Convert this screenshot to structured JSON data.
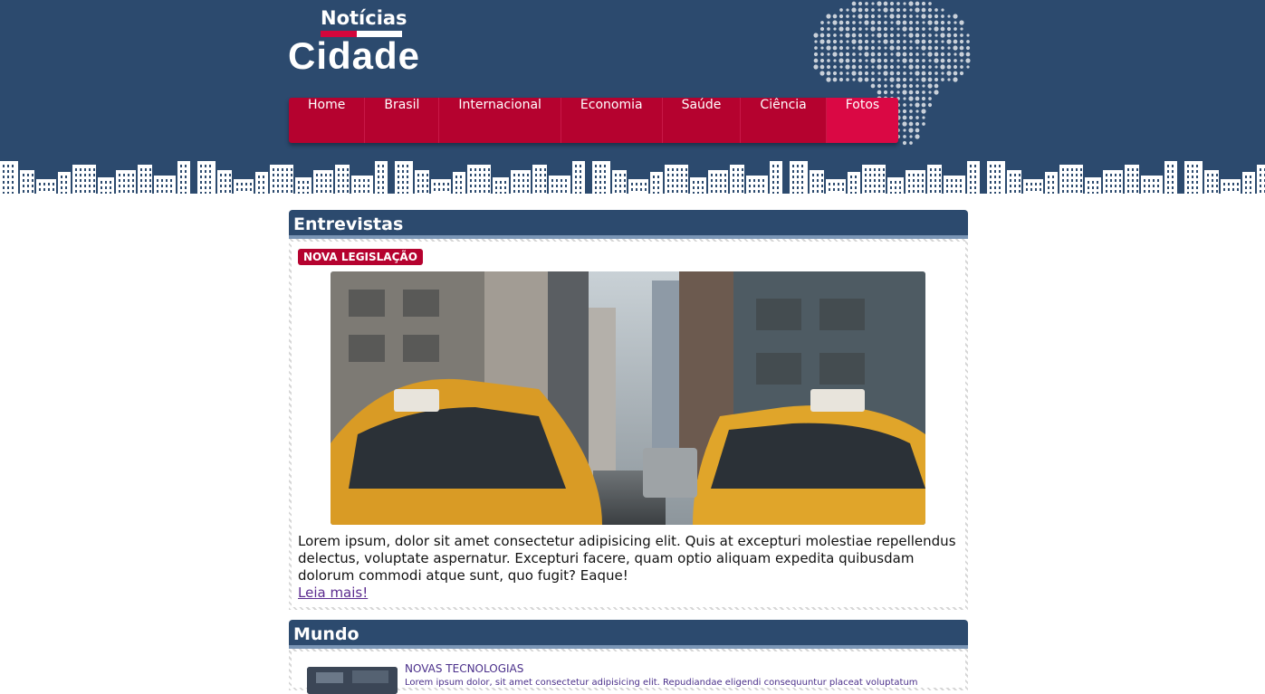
{
  "logo": {
    "small": "Notícias",
    "big": "Cidade"
  },
  "nav": {
    "items": [
      {
        "label": "Home"
      },
      {
        "label": "Brasil"
      },
      {
        "label": "Internacional"
      },
      {
        "label": "Economia"
      },
      {
        "label": "Saúde"
      },
      {
        "label": "Ciência"
      },
      {
        "label": "Fotos",
        "active": true
      }
    ]
  },
  "entrevistas": {
    "title": "Entrevistas",
    "badge": "NOVA LEGISLAÇÃO",
    "image_icon": "city-taxi-photo",
    "text": "Lorem ipsum, dolor sit amet consectetur adipisicing elit. Quis at excepturi molestiae repellendus delectus, voluptate aspernatur. Excepturi facere, quam optio aliquam expedita quibusdam dolorum commodi atque sunt, quo fugit? Eaque!",
    "read_more": "Leia mais!"
  },
  "mundo": {
    "title": "Mundo",
    "items": [
      {
        "title": "NOVAS TECNOLOGIAS",
        "text": "Lorem ipsum dolor, sit amet consectetur adipisicing elit. Repudiandae eligendi consequuntur placeat voluptatum"
      }
    ]
  },
  "colors": {
    "header_bg": "#2c4a6e",
    "nav_bg": "#b5022f",
    "nav_active": "#da0844",
    "accent": "#d4063c"
  }
}
